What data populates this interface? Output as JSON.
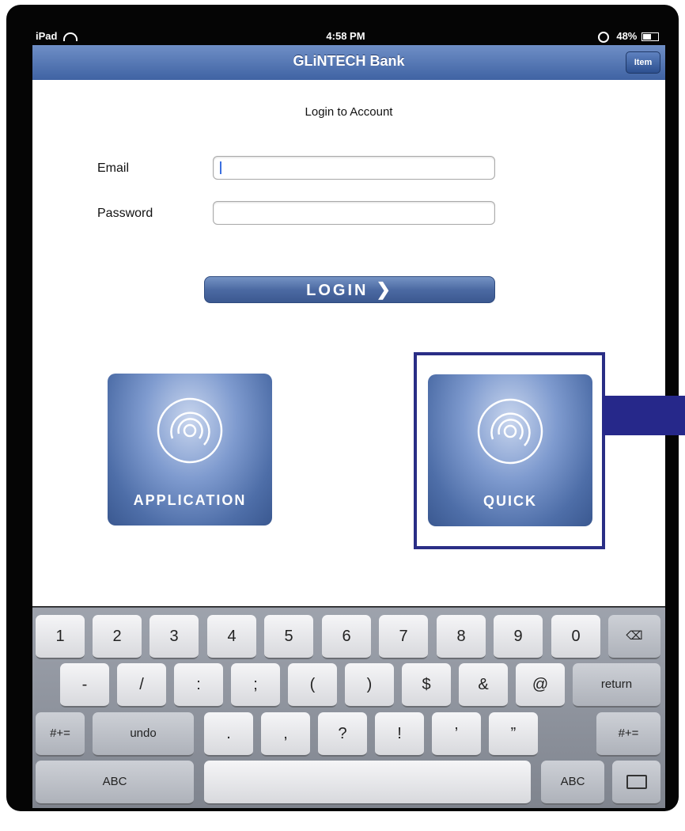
{
  "status_bar": {
    "device": "iPad",
    "time": "4:58 PM",
    "battery": "48%"
  },
  "nav": {
    "title": "GLiNTECH Bank",
    "item_button": "Item"
  },
  "login": {
    "heading": "Login to Account",
    "email_label": "Email",
    "password_label": "Password",
    "email_value": "",
    "password_value": "",
    "button_label": "LOGIN",
    "button_chevron": "❯"
  },
  "tiles": [
    {
      "label": "APPLICATION"
    },
    {
      "label": "QUICK"
    }
  ],
  "keyboard": {
    "row1": [
      "1",
      "2",
      "3",
      "4",
      "5",
      "6",
      "7",
      "8",
      "9",
      "0"
    ],
    "backspace": "⌫",
    "row2": [
      "-",
      "/",
      ":",
      ";",
      "(",
      ")",
      "$",
      "&",
      "@"
    ],
    "return": "return",
    "row3_left": "#+=",
    "undo": "undo",
    "row3": [
      ".",
      ",",
      "?",
      "!",
      "’",
      "”"
    ],
    "row3_right": "#+=",
    "abc_left": "ABC",
    "space": "",
    "abc_right": "ABC"
  }
}
